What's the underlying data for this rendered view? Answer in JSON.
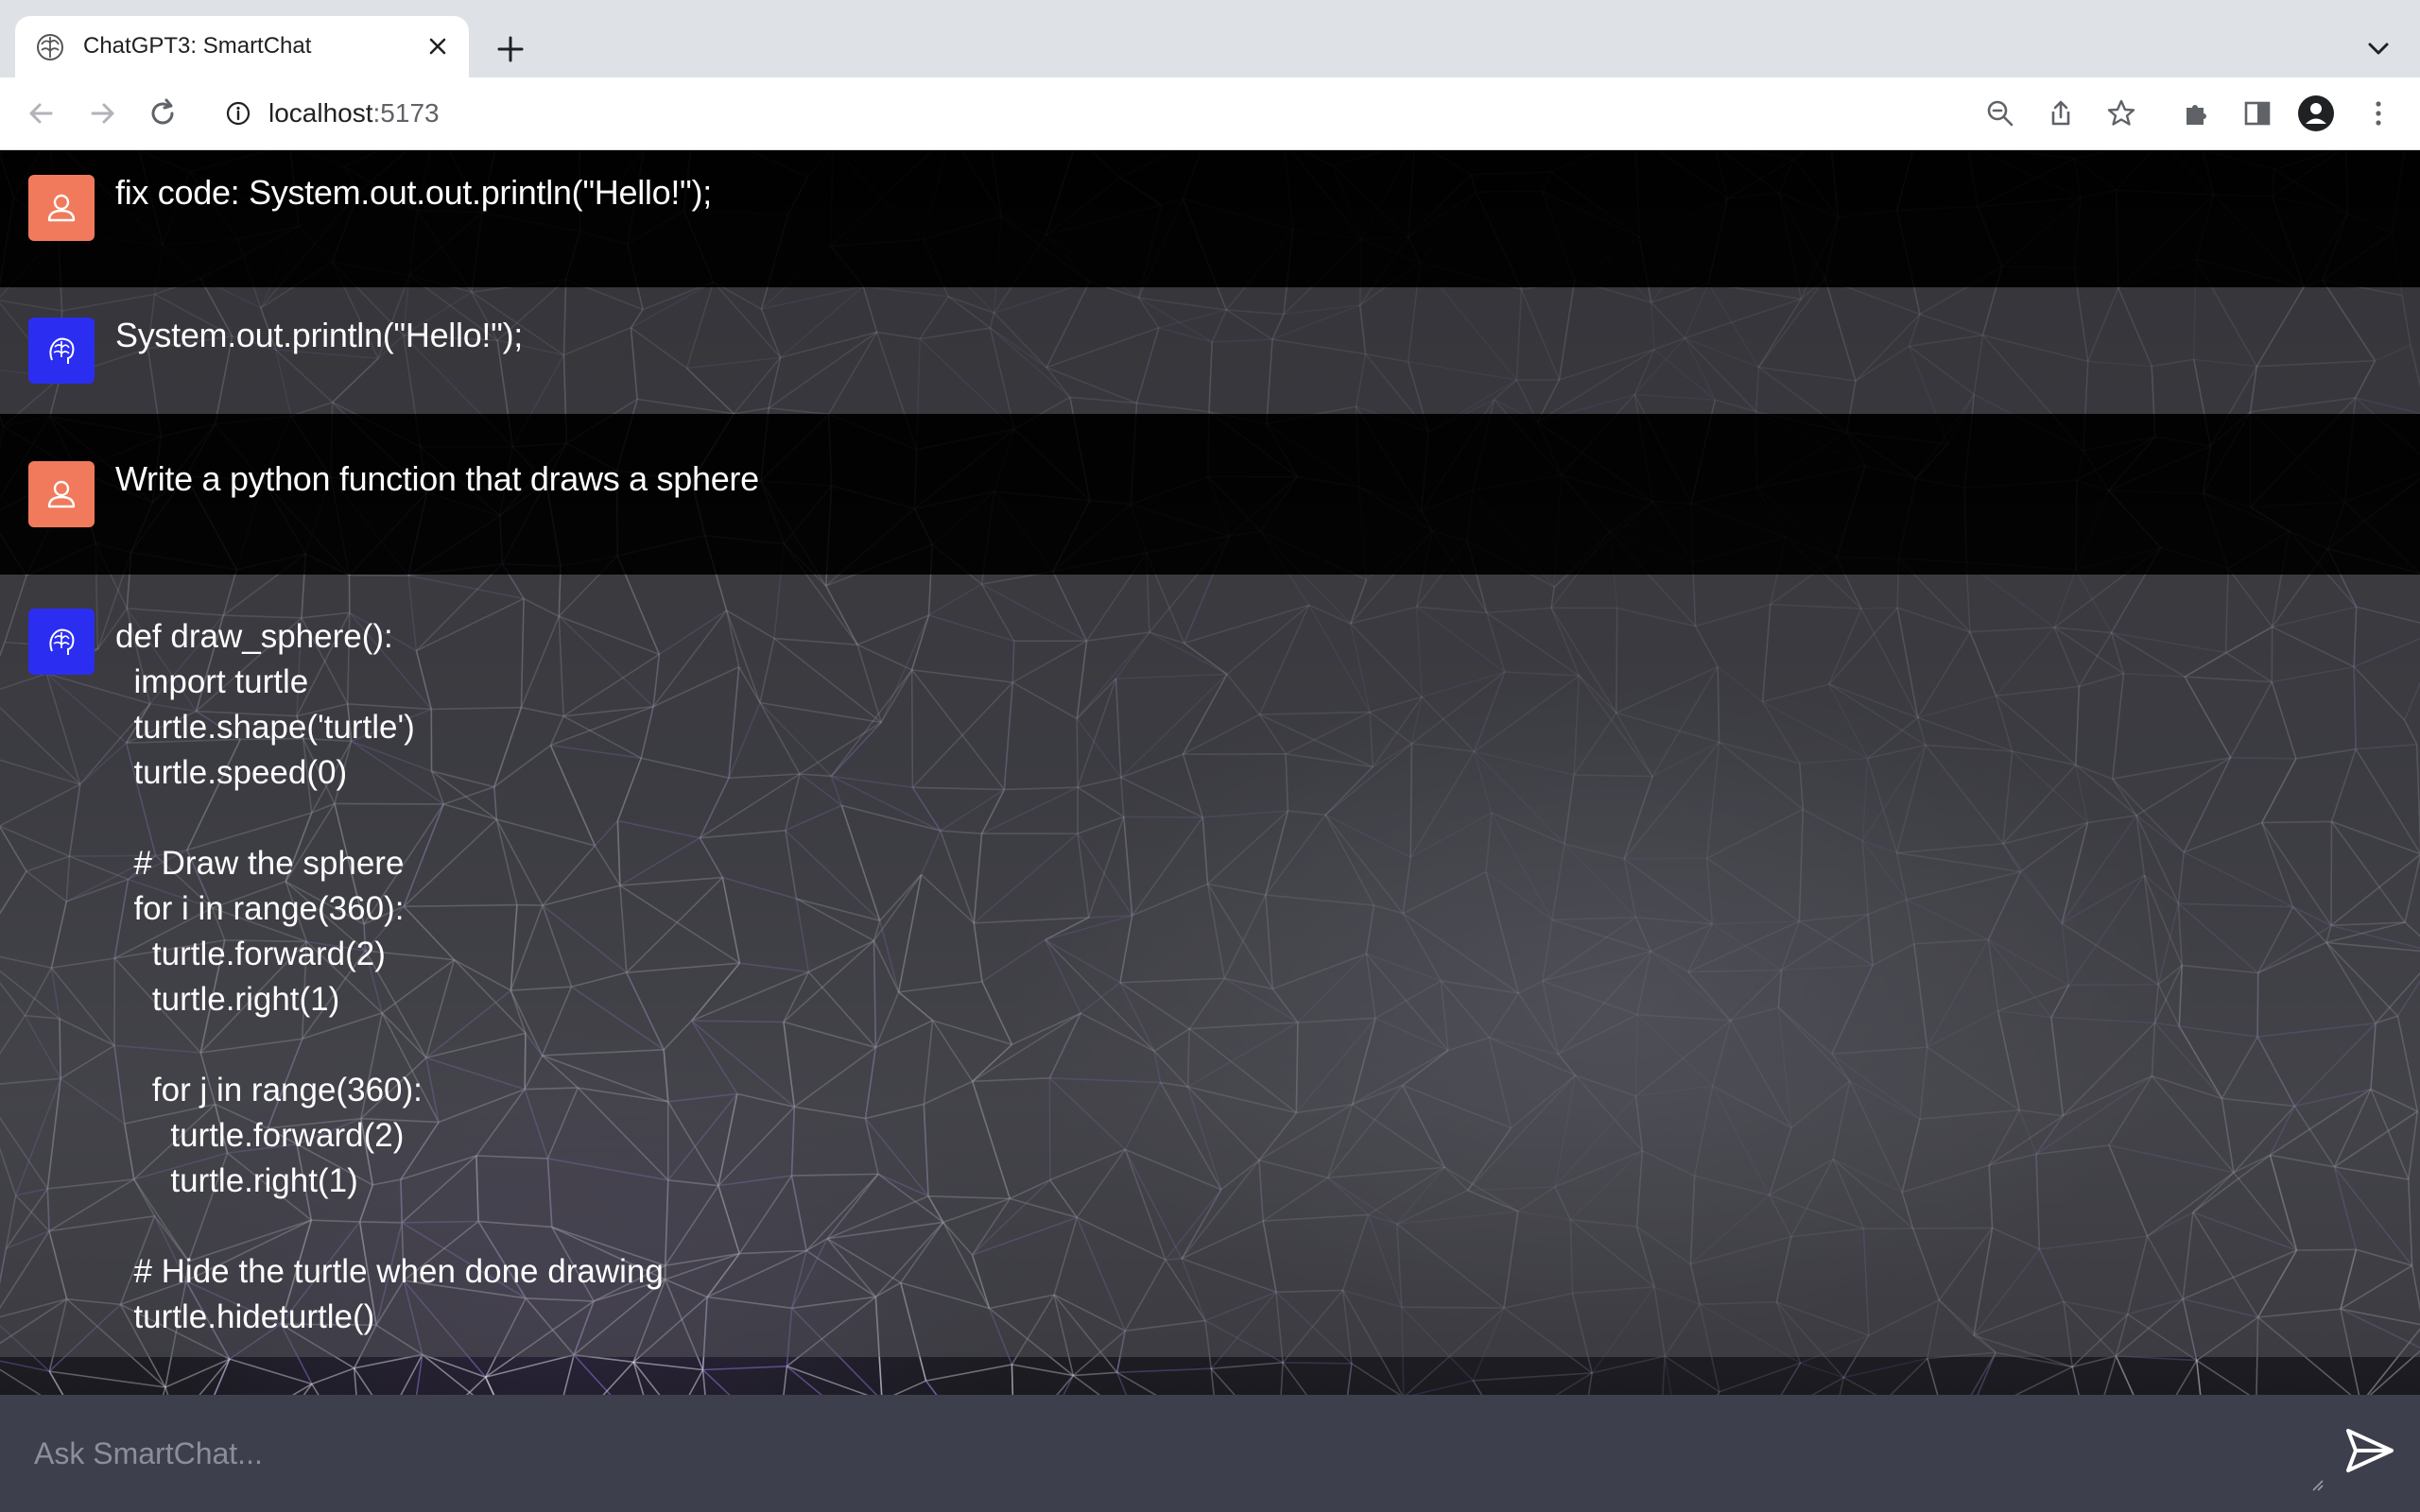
{
  "browser": {
    "tab_title": "ChatGPT3: SmartChat",
    "url_host": "localhost",
    "url_port": ":5173"
  },
  "messages": [
    {
      "role": "user",
      "text": "fix code: System.out.out.println(\"Hello!\");"
    },
    {
      "role": "assistant",
      "text": "System.out.println(\"Hello!\");"
    },
    {
      "role": "user",
      "text": "Write a python function that draws a sphere"
    },
    {
      "role": "assistant",
      "code_lines": [
        "def draw_sphere():",
        "  import turtle",
        "  turtle.shape('turtle')",
        "  turtle.speed(0)",
        "",
        "  # Draw the sphere",
        "  for i in range(360):",
        "    turtle.forward(2)",
        "    turtle.right(1)",
        "",
        "    for j in range(360):",
        "      turtle.forward(2)",
        "      turtle.right(1)",
        "",
        "  # Hide the turtle when done drawing",
        "  turtle.hideturtle()"
      ]
    }
  ],
  "composer": {
    "placeholder": "Ask SmartChat...",
    "value": ""
  },
  "colors": {
    "user_avatar": "#f07a5b",
    "assistant_avatar": "#2b2ef0",
    "composer_bg": "#3e3f4c"
  }
}
